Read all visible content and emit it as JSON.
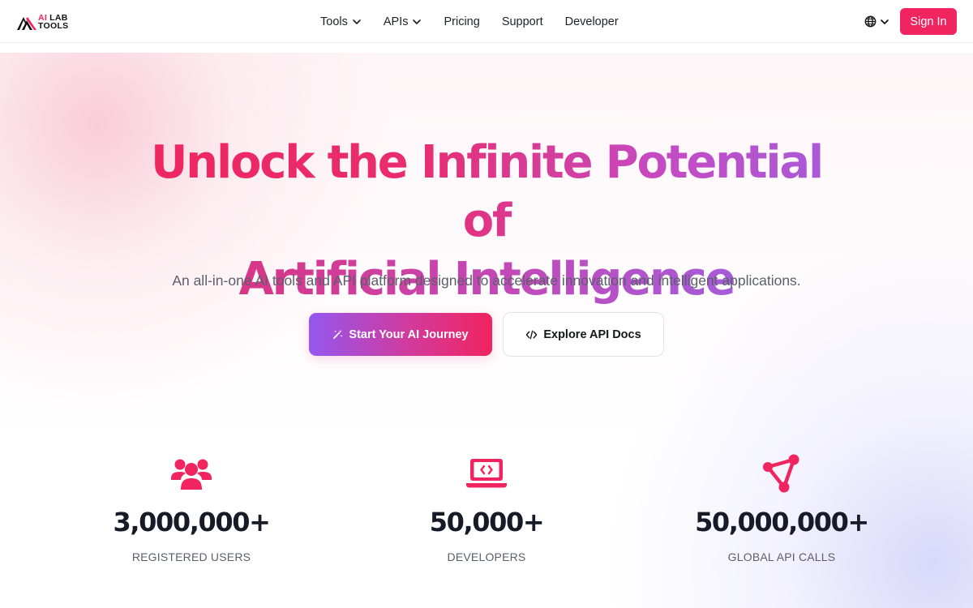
{
  "brand": {
    "logo_ai": "AI",
    "logo_lab": "LAB",
    "logo_tools": "TOOLS"
  },
  "nav": {
    "items": [
      {
        "label": "Tools",
        "has_dropdown": true
      },
      {
        "label": "APIs",
        "has_dropdown": true
      },
      {
        "label": "Pricing",
        "has_dropdown": false
      },
      {
        "label": "Support",
        "has_dropdown": false
      },
      {
        "label": "Developer",
        "has_dropdown": false
      }
    ],
    "language_icon": "globe-icon",
    "signin_label": "Sign In"
  },
  "hero": {
    "title_line1": "Unlock the Infinite Potential of",
    "title_line2": "Artificial Intelligence",
    "subtitle": "An all-in-one AI tools and API platform designed to accelerate innovation and intelligent applications.",
    "primary_cta": "Start Your AI Journey",
    "primary_cta_icon": "magic-wand-icon",
    "secondary_cta": "Explore API Docs",
    "secondary_cta_icon": "code-icon"
  },
  "stats": [
    {
      "value": "3,000,000+",
      "label": "REGISTERED USERS",
      "icon": "users-icon"
    },
    {
      "value": "50,000+",
      "label": "DEVELOPERS",
      "icon": "laptop-code-icon"
    },
    {
      "value": "50,000,000+",
      "label": "GLOBAL API CALLS",
      "icon": "nodes-icon"
    }
  ],
  "colors": {
    "accent": "#f0245f",
    "accent_purple": "#9457f0",
    "text_dark": "#171a27",
    "text_muted": "#5b5f6b"
  }
}
